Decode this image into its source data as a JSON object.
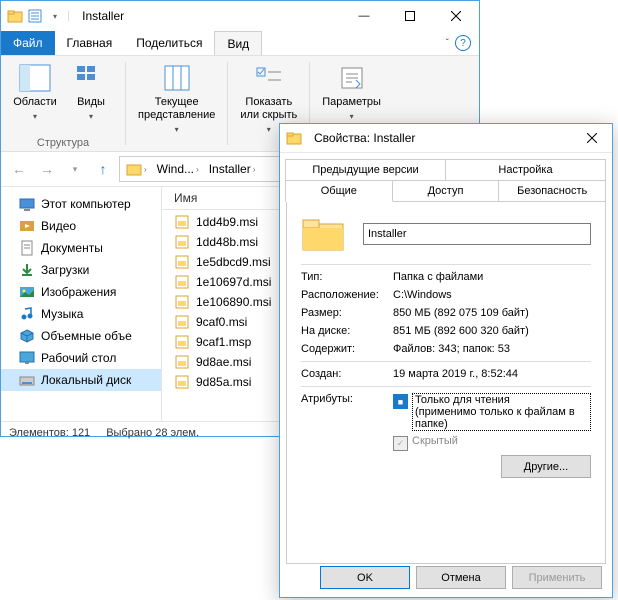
{
  "explorer": {
    "title": "Installer",
    "menus": {
      "file": "Файл",
      "home": "Главная",
      "share": "Поделиться",
      "view": "Вид"
    },
    "ribbon": {
      "panes": "Области",
      "views": "Виды",
      "current": "Текущее\nпредставление",
      "showhide": "Показать\nили скрыть",
      "options": "Параметры",
      "group_structure": "Структура"
    },
    "breadcrumb": {
      "segments": [
        "Wind...",
        "Installer"
      ]
    },
    "nav": {
      "items": [
        {
          "icon": "pc",
          "label": "Этот компьютер"
        },
        {
          "icon": "video",
          "label": "Видео"
        },
        {
          "icon": "doc",
          "label": "Документы"
        },
        {
          "icon": "download",
          "label": "Загрузки"
        },
        {
          "icon": "picture",
          "label": "Изображения"
        },
        {
          "icon": "music",
          "label": "Музыка"
        },
        {
          "icon": "3d",
          "label": "Объемные объе"
        },
        {
          "icon": "desktop",
          "label": "Рабочий стол"
        },
        {
          "icon": "disk",
          "label": "Локальный диск"
        }
      ]
    },
    "list": {
      "column": "Имя",
      "files": [
        "1dd4b9.msi",
        "1dd48b.msi",
        "1e5dbcd9.msi",
        "1e10697d.msi",
        "1e106890.msi",
        "9caf0.msi",
        "9caf1.msp",
        "9d8ae.msi",
        "9d85a.msi"
      ]
    },
    "status": {
      "elements": "Элементов: 121",
      "selected": "Выбрано 28 элем."
    }
  },
  "props": {
    "title": "Свойства: Installer",
    "tabs": {
      "prev": "Предыдущие версии",
      "custom": "Настройка",
      "general": "Общие",
      "share": "Доступ",
      "security": "Безопасность"
    },
    "name": "Installer",
    "rows": {
      "type_l": "Тип:",
      "type_v": "Папка с файлами",
      "loc_l": "Расположение:",
      "loc_v": "C:\\Windows",
      "size_l": "Размер:",
      "size_v": "850 МБ (892 075 109 байт)",
      "disk_l": "На диске:",
      "disk_v": "851 МБ (892 600 320 байт)",
      "contains_l": "Содержит:",
      "contains_v": "Файлов: 343; папок: 53",
      "created_l": "Создан:",
      "created_v": "19 марта 2019 г., 8:52:44",
      "attr_l": "Атрибуты:",
      "readonly": "Только для чтения",
      "readonly_note": "(применимо только к файлам в папке)",
      "hidden": "Скрытый",
      "other": "Другие..."
    },
    "buttons": {
      "ok": "OK",
      "cancel": "Отмена",
      "apply": "Применить"
    }
  }
}
